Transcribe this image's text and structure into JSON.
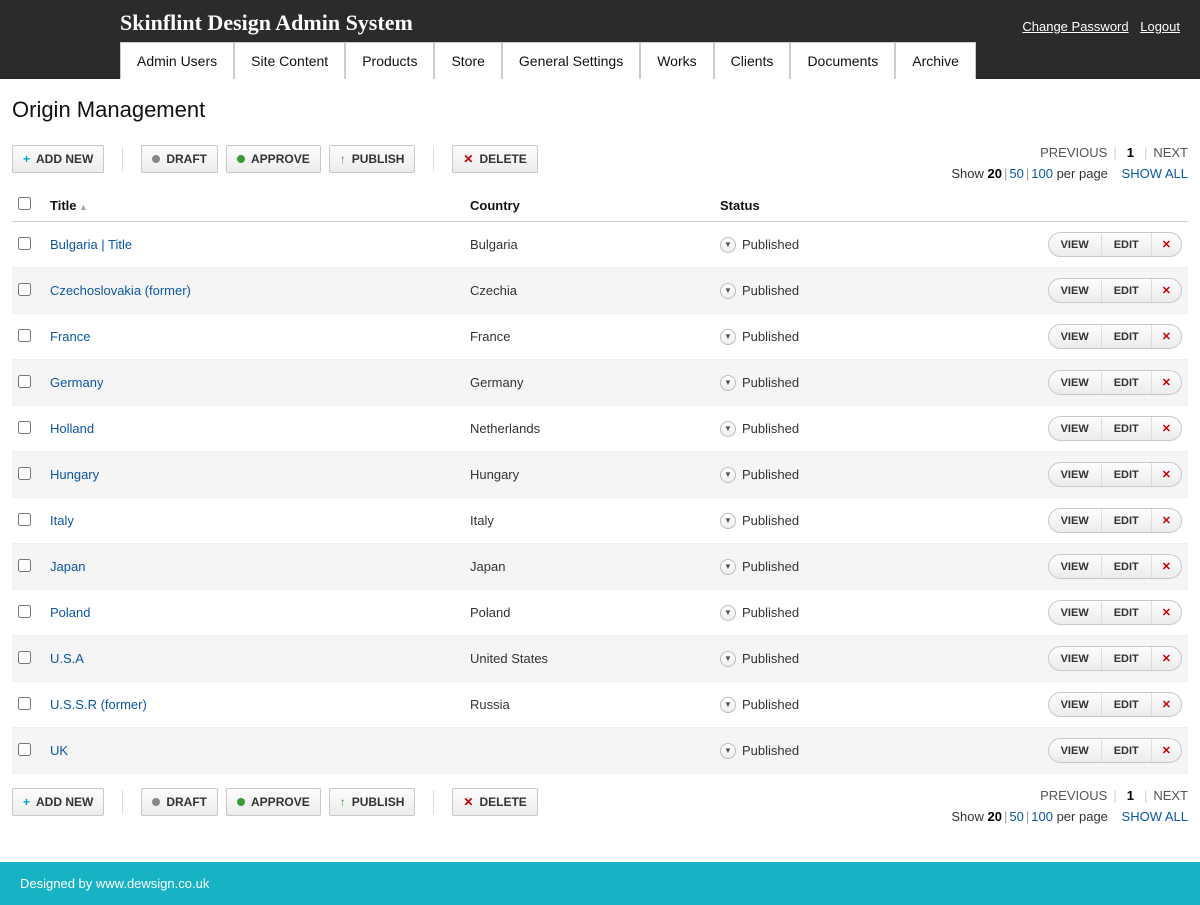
{
  "header": {
    "title": "Skinflint Design Admin System",
    "changePassword": "Change Password",
    "logout": "Logout"
  },
  "nav": [
    "Admin Users",
    "Site Content",
    "Products",
    "Store",
    "General Settings",
    "Works",
    "Clients",
    "Documents",
    "Archive"
  ],
  "page": {
    "title": "Origin Management"
  },
  "toolbar": {
    "addNew": "ADD NEW",
    "draft": "DRAFT",
    "approve": "APPROVE",
    "publish": "PUBLISH",
    "delete": "DELETE"
  },
  "pager": {
    "prev": "PREVIOUS",
    "page": "1",
    "next": "NEXT",
    "showLabel": "Show",
    "opt1": "20",
    "opt2": "50",
    "opt3": "100",
    "perPage": "per page",
    "showAll": "SHOW ALL"
  },
  "columns": {
    "title": "Title",
    "country": "Country",
    "status": "Status"
  },
  "rowActions": {
    "view": "VIEW",
    "edit": "EDIT"
  },
  "rows": [
    {
      "title": "Bulgaria | Title",
      "country": "Bulgaria",
      "status": "Published"
    },
    {
      "title": "Czechoslovakia (former)",
      "country": "Czechia",
      "status": "Published"
    },
    {
      "title": "France",
      "country": "France",
      "status": "Published"
    },
    {
      "title": "Germany",
      "country": "Germany",
      "status": "Published"
    },
    {
      "title": "Holland",
      "country": "Netherlands",
      "status": "Published"
    },
    {
      "title": "Hungary",
      "country": "Hungary",
      "status": "Published"
    },
    {
      "title": "Italy",
      "country": "Italy",
      "status": "Published"
    },
    {
      "title": "Japan",
      "country": "Japan",
      "status": "Published"
    },
    {
      "title": "Poland",
      "country": "Poland",
      "status": "Published"
    },
    {
      "title": "U.S.A",
      "country": "United States",
      "status": "Published"
    },
    {
      "title": "U.S.S.R (former)",
      "country": "Russia",
      "status": "Published"
    },
    {
      "title": "UK",
      "country": "",
      "status": "Published"
    }
  ],
  "footer": {
    "label": "Designed by ",
    "link": "www.dewsign.co.uk"
  }
}
